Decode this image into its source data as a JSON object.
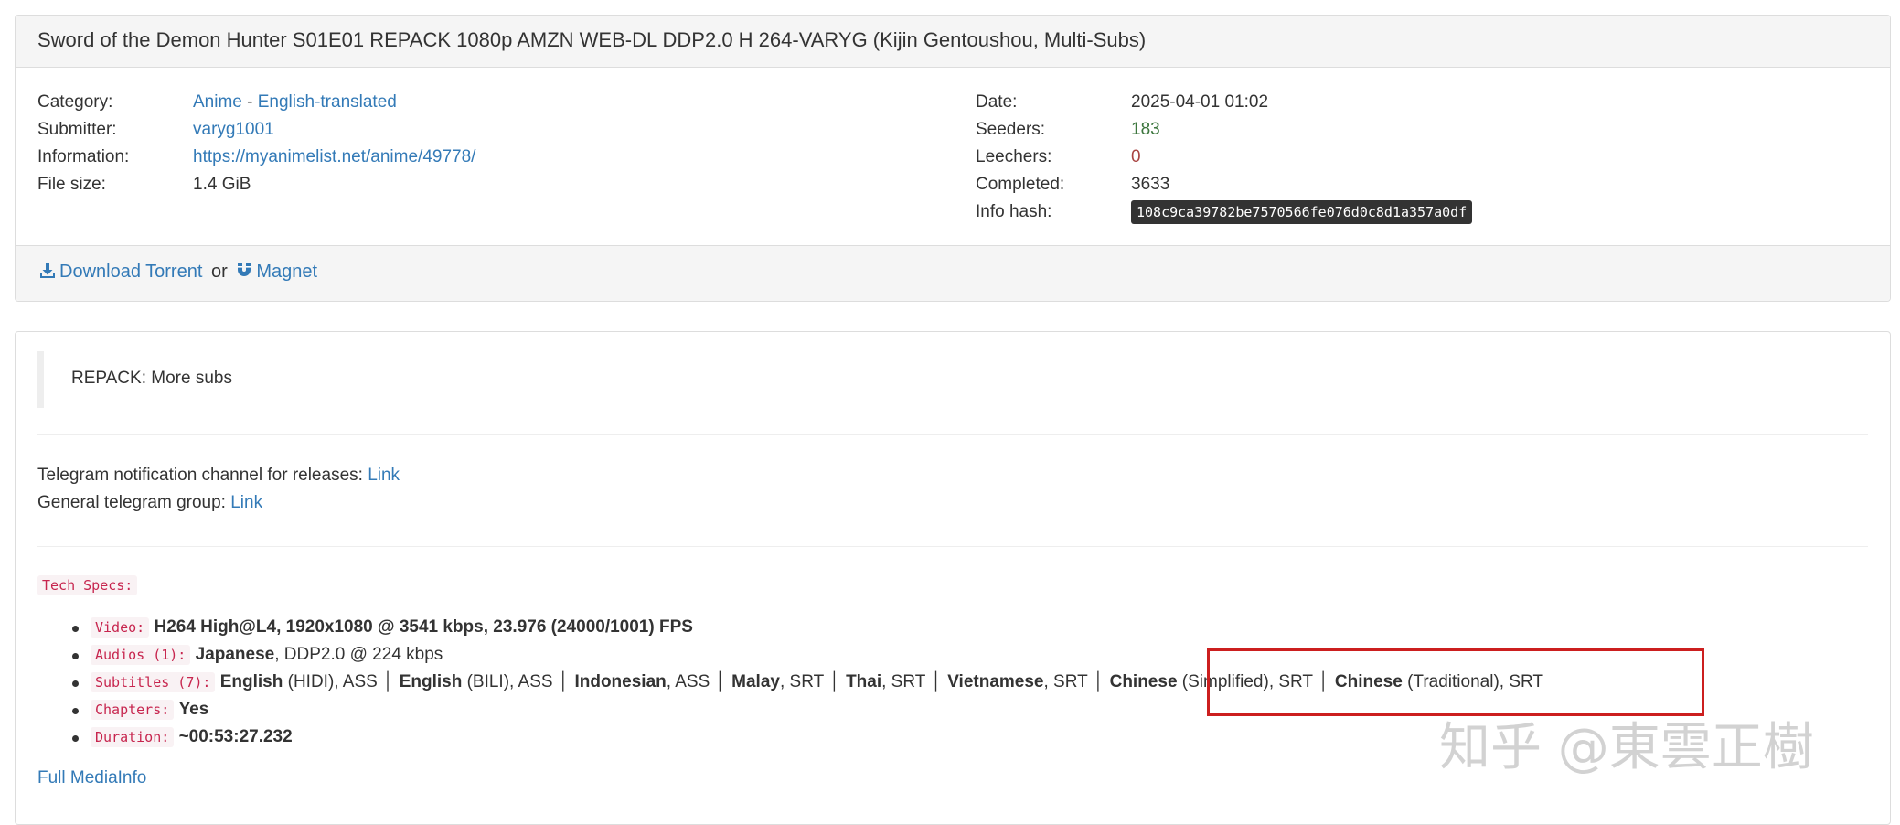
{
  "torrent": {
    "title": "Sword of the Demon Hunter S01E01 REPACK 1080p AMZN WEB-DL DDP2.0 H 264-VARYG (Kijin Gentoushou, Multi-Subs)",
    "category_label": "Category:",
    "category_main": "Anime",
    "category_sep": " - ",
    "category_sub": "English-translated",
    "submitter_label": "Submitter:",
    "submitter": "varyg1001",
    "information_label": "Information:",
    "information_url": "https://myanimelist.net/anime/49778/",
    "filesize_label": "File size:",
    "filesize": "1.4 GiB",
    "date_label": "Date:",
    "date": "2025-04-01 01:02",
    "seeders_label": "Seeders:",
    "seeders": "183",
    "leechers_label": "Leechers:",
    "leechers": "0",
    "completed_label": "Completed:",
    "completed": "3633",
    "infohash_label": "Info hash:",
    "infohash": "108c9ca39782be7570566fe076d0c8d1a357a0df",
    "download_label": "Download Torrent",
    "or_text": "or",
    "magnet_label": "Magnet"
  },
  "description": {
    "repack_note": "REPACK: More subs",
    "telegram_channel_text": "Telegram notification channel for releases:",
    "telegram_channel_link": "Link",
    "telegram_group_text": "General telegram group:",
    "telegram_group_link": "Link",
    "tech_specs_label": "Tech Specs:",
    "video_label": "Video:",
    "video_value": "H264 High@L4, 1920x1080 @ 3541 kbps, 23.976 (24000/1001) FPS",
    "audios_label": "Audios (1):",
    "audio_lang": "Japanese",
    "audio_rest": ", DDP2.0 @ 224 kbps",
    "subtitles_label": "Subtitles (7):",
    "subtitles": [
      {
        "lang": "English",
        "rest": " (HIDI), ASS"
      },
      {
        "lang": "English",
        "rest": " (BILI), ASS"
      },
      {
        "lang": "Indonesian",
        "rest": ", ASS"
      },
      {
        "lang": "Malay",
        "rest": ", SRT"
      },
      {
        "lang": "Thai",
        "rest": ", SRT"
      },
      {
        "lang": "Vietnamese",
        "rest": ", SRT"
      },
      {
        "lang": "Chinese",
        "rest": " (Simplified), SRT"
      },
      {
        "lang": "Chinese",
        "rest": " (Traditional), SRT"
      }
    ],
    "subtitle_separator": "│",
    "chapters_label": "Chapters:",
    "chapters_value": "Yes",
    "duration_label": "Duration:",
    "duration_value": "~00:53:27.232",
    "full_mediainfo": "Full MediaInfo"
  },
  "watermark": "知乎 @東雲正樹",
  "colors": {
    "link": "#337ab7",
    "seeders": "#3c763d",
    "leechers": "#a94442",
    "highlight_box": "#cc1f1f"
  }
}
